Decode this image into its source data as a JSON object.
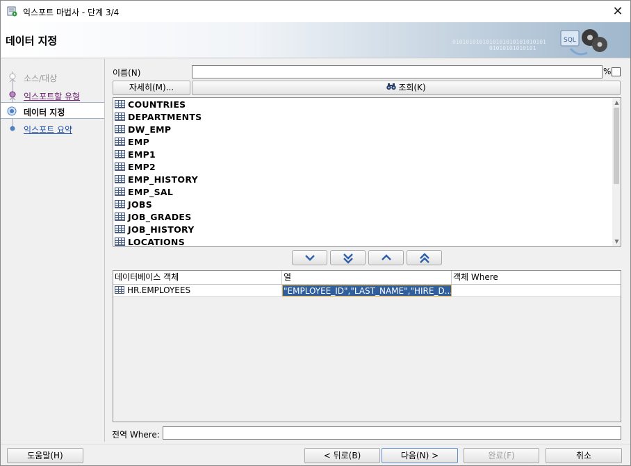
{
  "window": {
    "title": "익스포트 마법사 - 단계 3/4",
    "close_glyph": "✕"
  },
  "banner": {
    "title": "데이터 지정",
    "binary_text": "0101010101010101010101010101\n           01010101010101",
    "graphic_label": "SQL"
  },
  "nav": {
    "steps": [
      {
        "label": "소스/대상",
        "state": "visited"
      },
      {
        "label": "익스포트할 유형",
        "state": "link-visited"
      },
      {
        "label": "데이터 지정",
        "state": "current"
      },
      {
        "label": "익스포트 요약",
        "state": "link"
      }
    ]
  },
  "filter": {
    "name_label": "이름(N)",
    "name_value": "",
    "percent_label": "%",
    "details_button": "자세히(M)...",
    "query_button": "조회(K)"
  },
  "object_list": {
    "items": [
      "COUNTRIES",
      "DEPARTMENTS",
      "DW_EMP",
      "EMP",
      "EMP1",
      "EMP2",
      "EMP_HISTORY",
      "EMP_SAL",
      "JOBS",
      "JOB_GRADES",
      "JOB_HISTORY",
      "LOCATIONS"
    ]
  },
  "selected": {
    "columns": [
      "데이터베이스 객체",
      "열",
      "객체 Where"
    ],
    "rows": [
      {
        "object": "HR.EMPLOYEES",
        "columns": "\"EMPLOYEE_ID\",\"LAST_NAME\",\"HIRE_D...",
        "where": ""
      }
    ]
  },
  "global_where": {
    "label": "전역 Where:",
    "value": ""
  },
  "footer": {
    "help": "도움말(H)",
    "back": "< 뒤로(B)",
    "next": "다음(N) >",
    "finish": "완료(F)",
    "cancel": "취소"
  },
  "colors": {
    "selection": "#2f5f9e",
    "visited_link": "#6a1d6f",
    "link": "#1a4fb0",
    "current_step_border": "#9fb3c8"
  }
}
